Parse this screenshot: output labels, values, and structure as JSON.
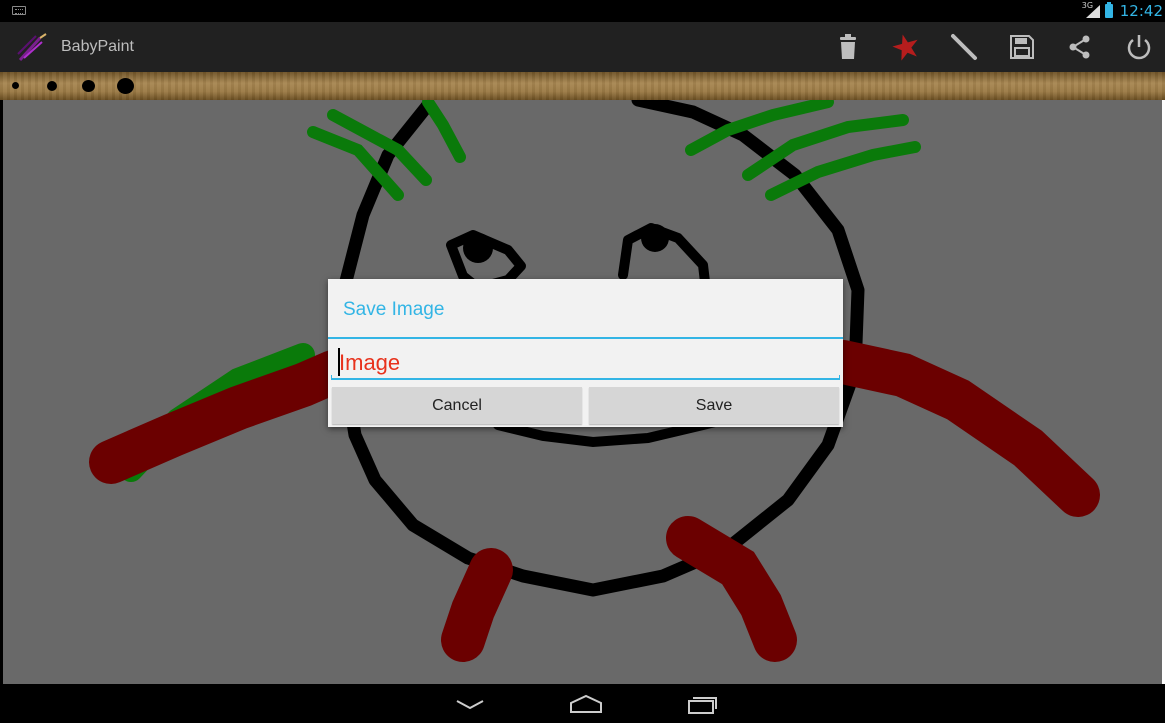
{
  "status_bar": {
    "network": "3G",
    "time": "12:42",
    "icons": [
      "keyboard-icon",
      "signal-icon",
      "battery-icon"
    ],
    "accent": "#33b5e5"
  },
  "app": {
    "title": "BabyPaint",
    "actions": [
      {
        "name": "trash-icon"
      },
      {
        "name": "eraser-star-icon"
      },
      {
        "name": "pencil-icon"
      },
      {
        "name": "save-icon"
      },
      {
        "name": "share-icon"
      },
      {
        "name": "power-icon"
      }
    ]
  },
  "brush_sizes": [
    "small",
    "medium",
    "large",
    "extra-large"
  ],
  "dialog": {
    "title": "Save Image",
    "input_value": "Image",
    "cancel_label": "Cancel",
    "save_label": "Save",
    "title_color": "#33b5e5",
    "input_text_color": "#e8321c"
  },
  "canvas": {
    "background": "#696969",
    "stroke_colors": [
      "#000000",
      "#0a7a0a",
      "#6b0000"
    ]
  },
  "navigation": [
    "back-icon",
    "home-icon",
    "recent-apps-icon"
  ]
}
